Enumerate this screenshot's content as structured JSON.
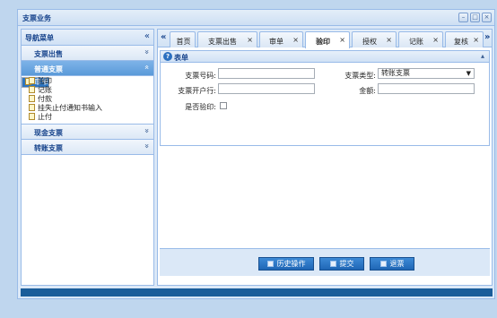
{
  "window": {
    "title": "支票业务"
  },
  "nav": {
    "title": "导航菜单",
    "collapse_glyph": "«",
    "sections": [
      {
        "label": "支票出售",
        "chevron": "»"
      },
      {
        "label": "普通支票",
        "chevron": "«",
        "items": [
          "审单",
          "验印",
          "记账",
          "付款",
          "挂失止付通知书输入",
          "止付"
        ]
      },
      {
        "label": "现金支票",
        "chevron": "»"
      },
      {
        "label": "转账支票",
        "chevron": "»"
      }
    ]
  },
  "tabs": {
    "scroll_left": "«",
    "scroll_right": "»",
    "items": [
      {
        "label": "首页"
      },
      {
        "label": "支票出售"
      },
      {
        "label": "审单"
      },
      {
        "label": "验印"
      },
      {
        "label": "授权"
      },
      {
        "label": "记账"
      },
      {
        "label": "复核"
      }
    ],
    "close_glyph": "×"
  },
  "panel": {
    "title": "表单",
    "icon_glyph": "?",
    "collapse_glyph": "▴"
  },
  "form": {
    "check_number_label": "支票号码:",
    "check_number_value": "",
    "check_type_label": "支票类型:",
    "check_type_value": "转账支票",
    "bank_label": "支票开户行:",
    "bank_value": "",
    "amount_label": "金额:",
    "amount_value": "",
    "verified_label": "是否验印:"
  },
  "buttons": {
    "history": "历史操作",
    "submit": "提交",
    "return": "退票"
  },
  "colors": {
    "accent": "#2e75c0",
    "status_bar": "#1a5d9a",
    "frame": "#99bbe8"
  }
}
